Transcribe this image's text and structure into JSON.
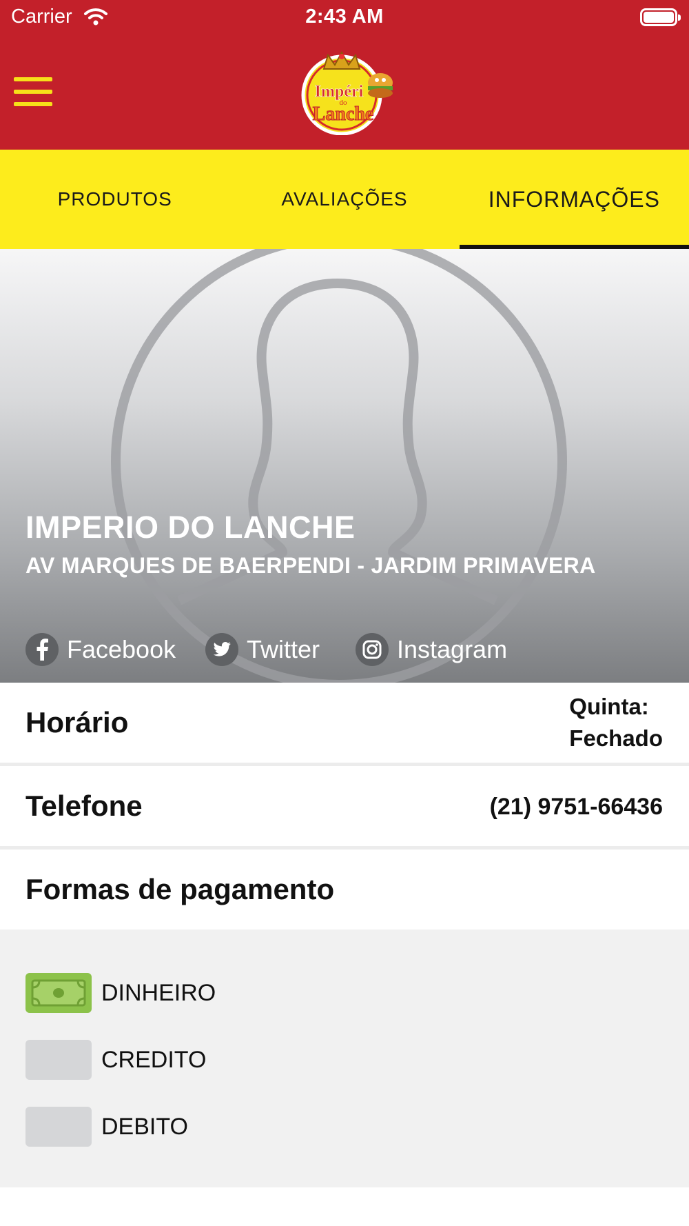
{
  "status_bar": {
    "carrier": "Carrier",
    "time": "2:43 AM"
  },
  "header": {
    "logo_text": [
      "Impéri",
      "do",
      "Lanche"
    ],
    "colors": {
      "header_bg": "#c3202a",
      "tab_bg": "#fdec1c",
      "accent": "#f7e019"
    }
  },
  "tabs": [
    {
      "label": "PRODUTOS",
      "active": false
    },
    {
      "label": "AVALIAÇÕES",
      "active": false
    },
    {
      "label": "INFORMAÇÕES",
      "active": true
    }
  ],
  "store": {
    "name": "IMPERIO DO LANCHE",
    "address": "AV MARQUES DE BAERPENDI - JARDIM PRIMAVERA"
  },
  "social": [
    {
      "label": "Facebook",
      "icon": "facebook-icon"
    },
    {
      "label": "Twitter",
      "icon": "twitter-icon"
    },
    {
      "label": "Instagram",
      "icon": "instagram-icon"
    }
  ],
  "info": {
    "hours_label": "Horário",
    "hours_value_line1": "Quinta:",
    "hours_value_line2": "Fechado",
    "phone_label": "Telefone",
    "phone_value": "(21) 9751-66436",
    "payments_label": "Formas de pagamento"
  },
  "payments": [
    {
      "label": "DINHEIRO",
      "icon": "cash-icon",
      "active": true
    },
    {
      "label": "CREDITO",
      "icon": "credit-card-icon",
      "active": false
    },
    {
      "label": "DEBITO",
      "icon": "debit-card-icon",
      "active": false
    }
  ]
}
